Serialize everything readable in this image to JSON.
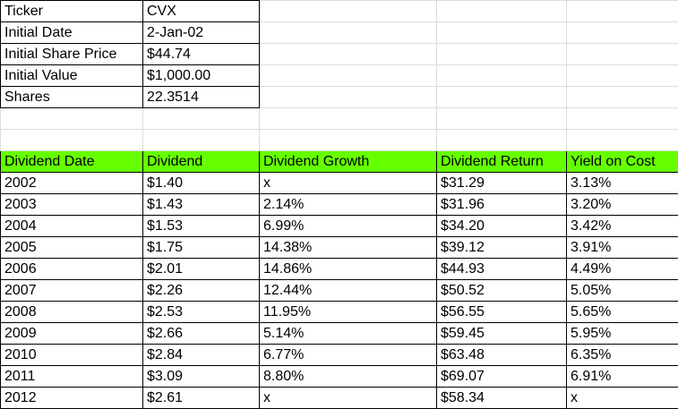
{
  "info": [
    {
      "label": "Ticker",
      "value": "CVX"
    },
    {
      "label": "Initial Date",
      "value": "2-Jan-02"
    },
    {
      "label": "Initial Share Price",
      "value": "$44.74"
    },
    {
      "label": "Initial Value",
      "value": "$1,000.00"
    },
    {
      "label": "Shares",
      "value": "22.3514"
    }
  ],
  "headers": [
    "Dividend Date",
    "Dividend",
    "Dividend Growth",
    "Dividend Return",
    "Yield on Cost"
  ],
  "rows": [
    [
      "2002",
      "$1.40",
      "x",
      "$31.29",
      "3.13%"
    ],
    [
      "2003",
      "$1.43",
      "2.14%",
      "$31.96",
      "3.20%"
    ],
    [
      "2004",
      "$1.53",
      "6.99%",
      "$34.20",
      "3.42%"
    ],
    [
      "2005",
      "$1.75",
      "14.38%",
      "$39.12",
      "3.91%"
    ],
    [
      "2006",
      "$2.01",
      "14.86%",
      "$44.93",
      "4.49%"
    ],
    [
      "2007",
      "$2.26",
      "12.44%",
      "$50.52",
      "5.05%"
    ],
    [
      "2008",
      "$2.53",
      "11.95%",
      "$56.55",
      "5.65%"
    ],
    [
      "2009",
      "$2.66",
      "5.14%",
      "$59.45",
      "5.95%"
    ],
    [
      "2010",
      "$2.84",
      "6.77%",
      "$63.48",
      "6.35%"
    ],
    [
      "2011",
      "$3.09",
      "8.80%",
      "$69.07",
      "6.91%"
    ],
    [
      "2012",
      "$2.61",
      "x",
      "$58.34",
      "x"
    ]
  ],
  "colors": {
    "header_fill": "#66ff00",
    "gridline": "#dadcdd",
    "border": "#000000"
  }
}
